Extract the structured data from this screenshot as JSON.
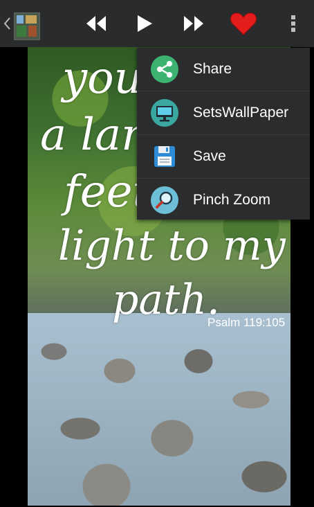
{
  "toolbar": {
    "buttons": [
      "rewind-icon",
      "play-icon",
      "fast-forward-icon",
      "heart-icon",
      "overflow-menu-icon"
    ],
    "colors": {
      "bar": "#2a2b2d",
      "heart": "#e31c1c",
      "icon": "#ffffff"
    }
  },
  "image": {
    "verse_lines": [
      "your",
      "a lam",
      "feet",
      "light to my",
      "path."
    ],
    "reference": "Psalm 119:105"
  },
  "menu": {
    "items": [
      {
        "label": "Share",
        "icon": "share-icon",
        "color": "#3cb371"
      },
      {
        "label": "SetsWallPaper",
        "icon": "monitor-icon",
        "color": "#3aa8a0"
      },
      {
        "label": "Save",
        "icon": "floppy-disk-icon",
        "color": "#2e8bd6"
      },
      {
        "label": "Pinch Zoom",
        "icon": "magnifier-icon",
        "color": "#6dbfd8"
      }
    ]
  }
}
